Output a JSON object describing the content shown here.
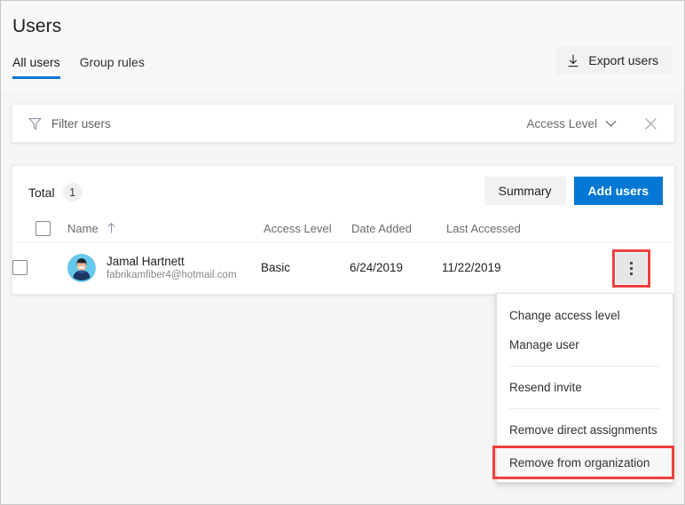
{
  "header": {
    "title": "Users",
    "tabs": [
      {
        "label": "All users",
        "active": true
      },
      {
        "label": "Group rules",
        "active": false
      }
    ],
    "export_button": {
      "label": "Export users",
      "icon": "download-icon"
    }
  },
  "filter_bar": {
    "filter_icon": "funnel-icon",
    "placeholder": "Filter users",
    "value": "",
    "access_level_dropdown": {
      "label": "Access Level",
      "icon": "chevron-down-icon"
    },
    "close_icon": "close-icon"
  },
  "grid": {
    "total_label": "Total",
    "total_count": "1",
    "summary_button": "Summary",
    "add_users_button": "Add users",
    "columns": [
      {
        "key": "select",
        "label": ""
      },
      {
        "key": "name",
        "label": "Name",
        "sort": "ascending",
        "sort_icon": "arrow-up-icon"
      },
      {
        "key": "access_level",
        "label": "Access Level"
      },
      {
        "key": "date_added",
        "label": "Date Added"
      },
      {
        "key": "last_accessed",
        "label": "Last Accessed"
      }
    ],
    "rows": [
      {
        "avatar": "user-avatar",
        "name": "Jamal Hartnett",
        "email": "fabrikamfiber4@hotmail.com",
        "access_level": "Basic",
        "date_added": "6/24/2019",
        "last_accessed": "11/22/2019",
        "menu_icon": "more-vertical-icon"
      }
    ]
  },
  "context_menu": {
    "items": [
      {
        "label": "Change access level",
        "highlighted": false
      },
      {
        "label": "Manage user",
        "highlighted": false
      },
      {
        "label": "Resend invite",
        "highlighted": false
      },
      {
        "label": "Remove direct assignments",
        "highlighted": false
      },
      {
        "label": "Remove from organization",
        "highlighted": true
      }
    ]
  },
  "colors": {
    "accent": "#0078d4",
    "highlight": "#f43f3f",
    "page_background": "#f5f5f5",
    "card_background": "#ffffff",
    "secondary_button": "#f3f2f1",
    "muted_text": "#6b6b6b"
  }
}
